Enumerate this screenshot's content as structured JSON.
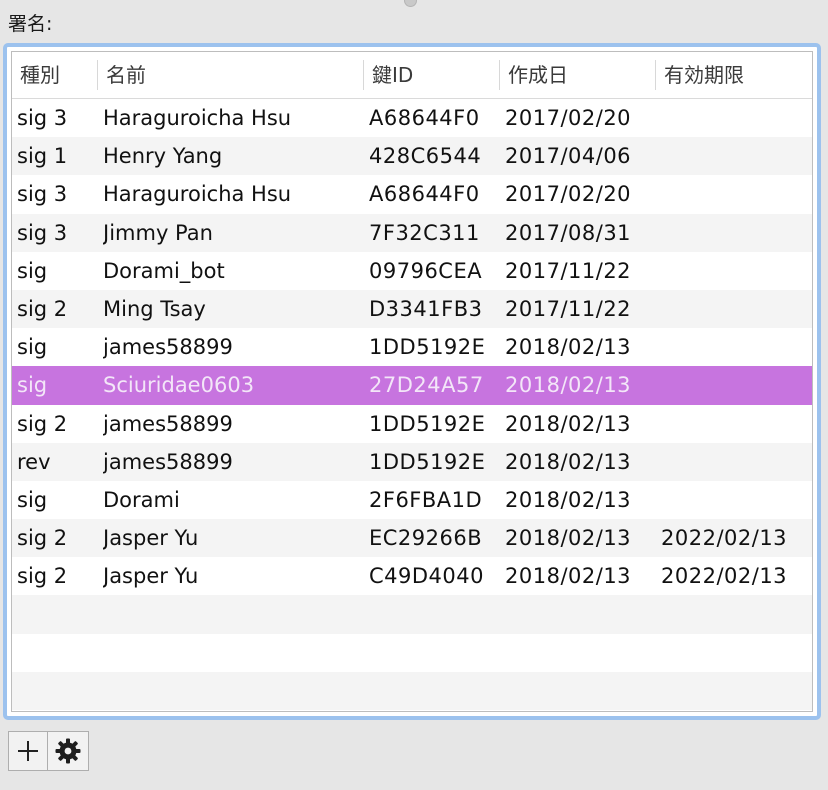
{
  "section_label": "署名:",
  "columns": {
    "type": "種別",
    "name": "名前",
    "key_id": "鍵ID",
    "created": "作成日",
    "expires": "有効期限"
  },
  "rows": [
    {
      "type": "sig 3",
      "name": "Haraguroicha Hsu",
      "key_id": "A68644F0",
      "created": "2017/02/20",
      "expires": ""
    },
    {
      "type": "sig 1",
      "name": "Henry Yang",
      "key_id": "428C6544",
      "created": "2017/04/06",
      "expires": ""
    },
    {
      "type": "sig 3",
      "name": "Haraguroicha Hsu",
      "key_id": "A68644F0",
      "created": "2017/02/20",
      "expires": ""
    },
    {
      "type": "sig 3",
      "name": "Jimmy Pan",
      "key_id": "7F32C311",
      "created": "2017/08/31",
      "expires": ""
    },
    {
      "type": "sig",
      "name": "Dorami_bot",
      "key_id": "09796CEA",
      "created": "2017/11/22",
      "expires": ""
    },
    {
      "type": "sig 2",
      "name": "Ming Tsay",
      "key_id": "D3341FB3",
      "created": "2017/11/22",
      "expires": ""
    },
    {
      "type": "sig",
      "name": "james58899",
      "key_id": "1DD5192E",
      "created": "2018/02/13",
      "expires": ""
    },
    {
      "type": "sig",
      "name": "Sciuridae0603",
      "key_id": "27D24A57",
      "created": "2018/02/13",
      "expires": "",
      "selected": true
    },
    {
      "type": "sig 2",
      "name": "james58899",
      "key_id": "1DD5192E",
      "created": "2018/02/13",
      "expires": ""
    },
    {
      "type": "rev",
      "name": "james58899",
      "key_id": "1DD5192E",
      "created": "2018/02/13",
      "expires": ""
    },
    {
      "type": "sig",
      "name": "Dorami",
      "key_id": "2F6FBA1D",
      "created": "2018/02/13",
      "expires": ""
    },
    {
      "type": "sig 2",
      "name": "Jasper Yu",
      "key_id": "EC29266B",
      "created": "2018/02/13",
      "expires": "2022/02/13"
    },
    {
      "type": "sig 2",
      "name": "Jasper Yu",
      "key_id": "C49D4040",
      "created": "2018/02/13",
      "expires": "2022/02/13"
    }
  ],
  "toolbar": {
    "add_icon": "plus-icon",
    "action_icon": "gear-icon"
  },
  "colors": {
    "selection": "#c774df",
    "focus_ring": "#9cc2ee",
    "stripe": "#f4f4f4"
  }
}
